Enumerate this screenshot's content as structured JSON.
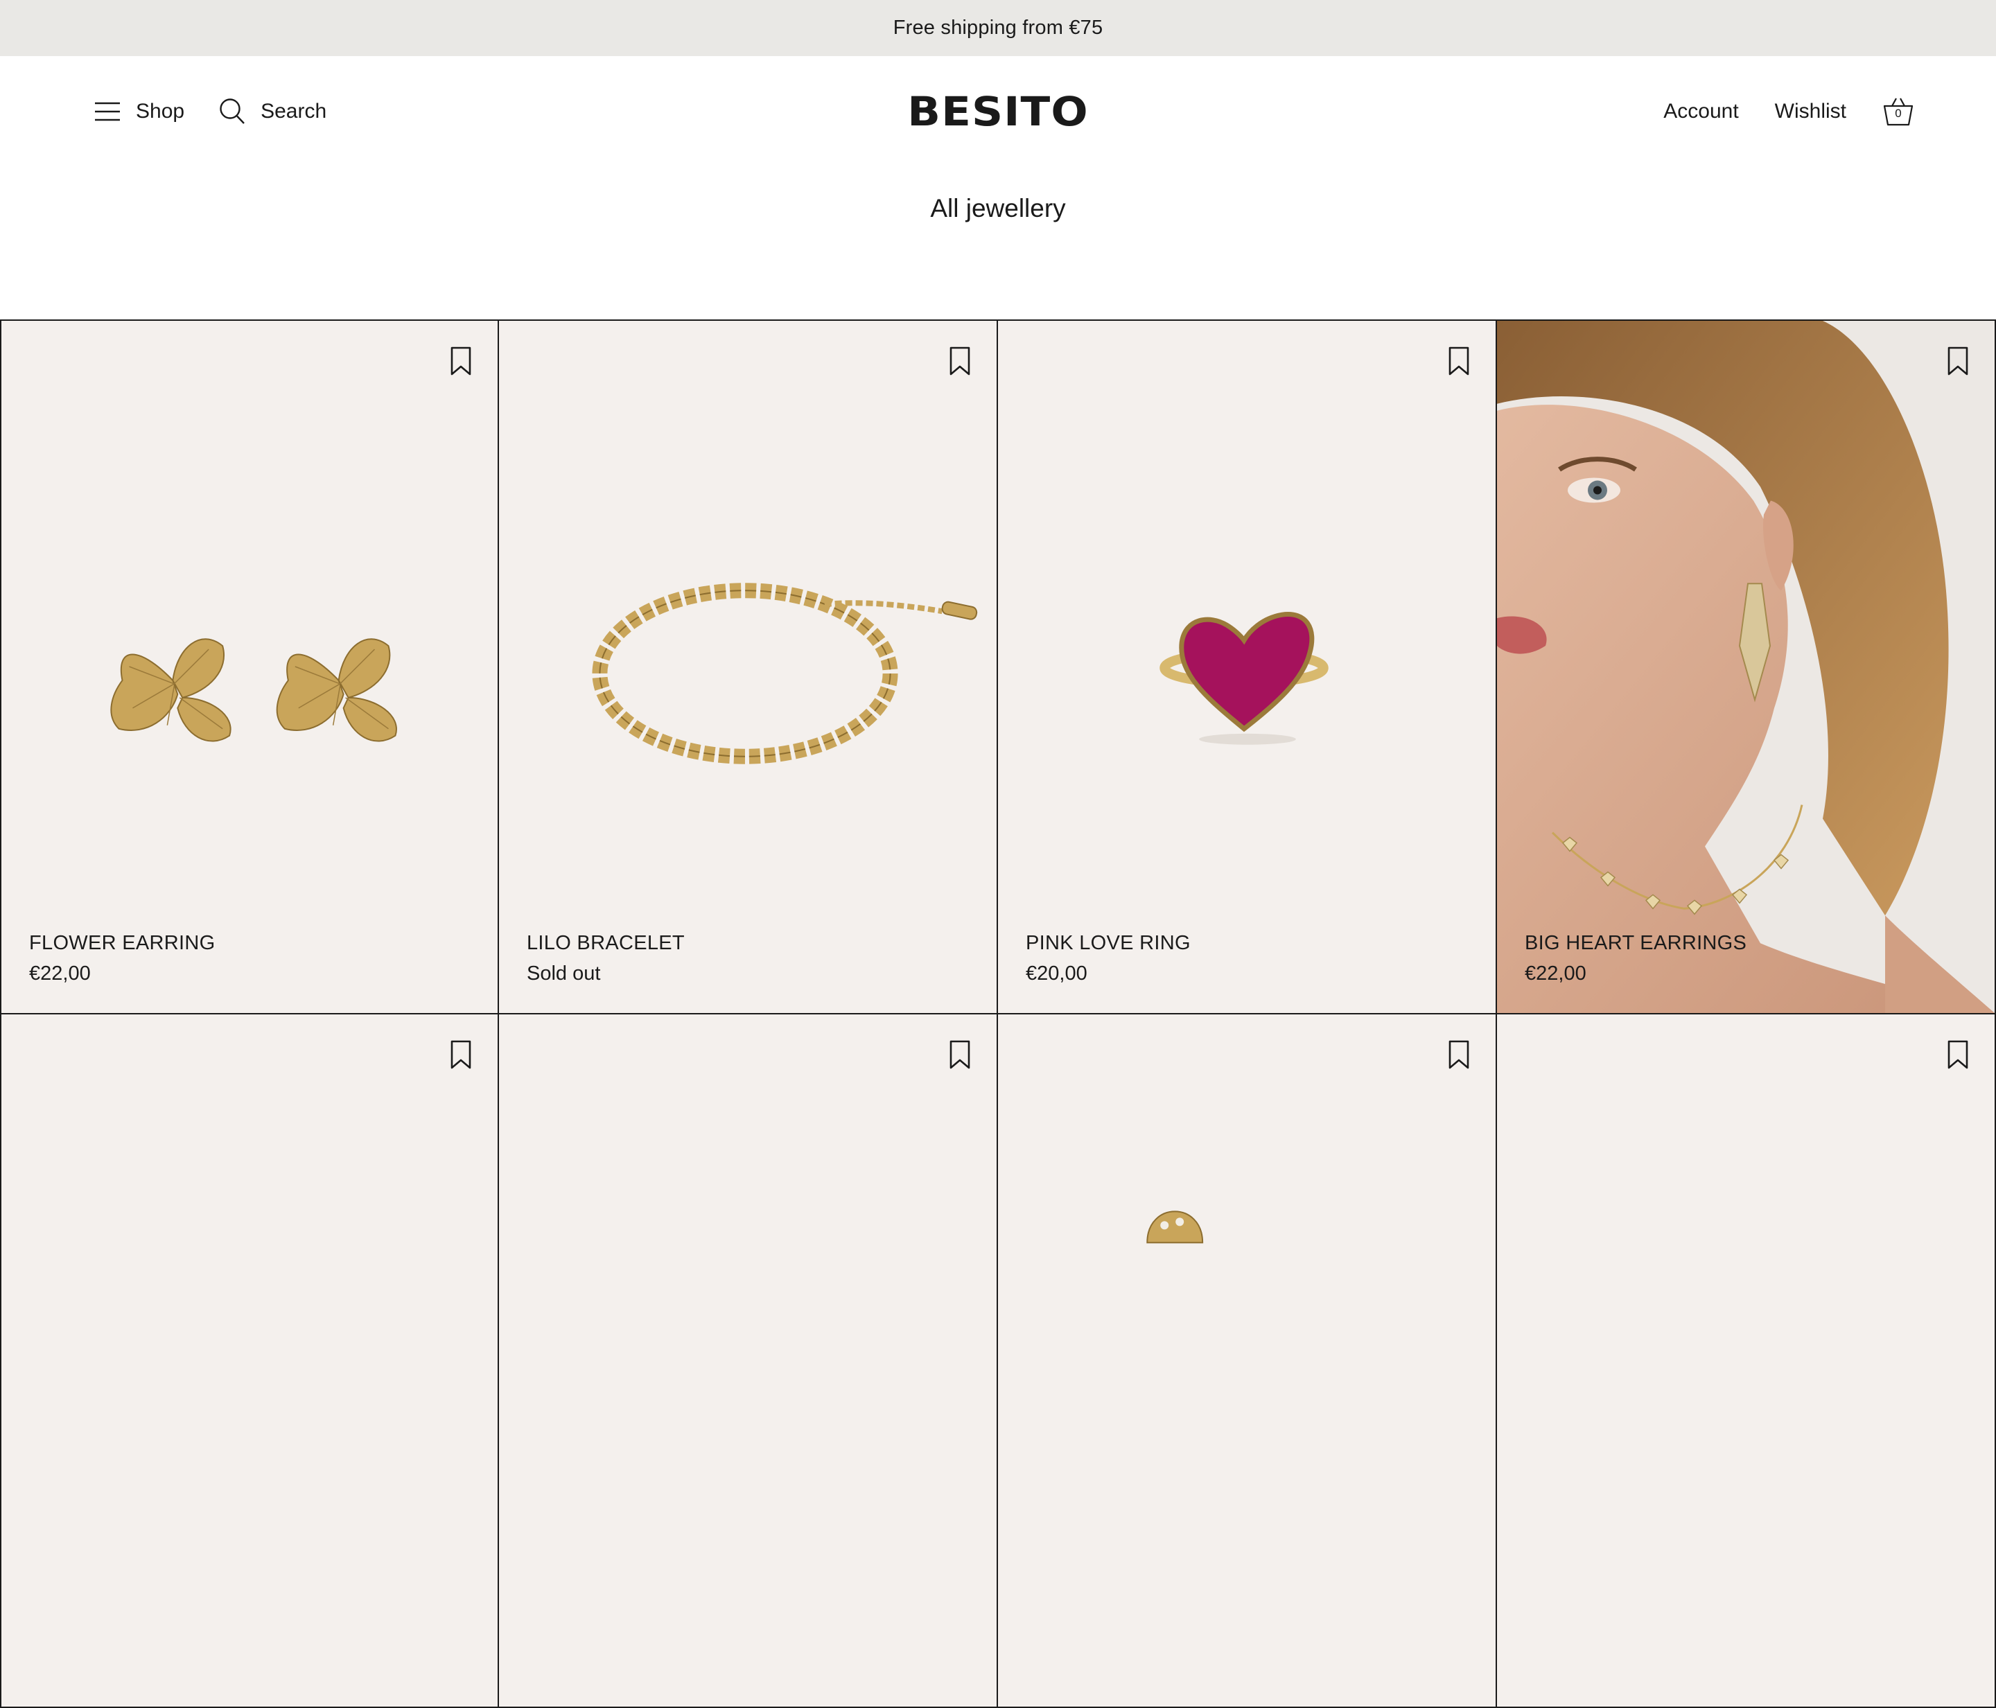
{
  "announcement": "Free shipping from €75",
  "header": {
    "shop_label": "Shop",
    "search_label": "Search",
    "logo": "BESITO",
    "account_label": "Account",
    "wishlist_label": "Wishlist",
    "cart_count": "0"
  },
  "page_title": "All jewellery",
  "products": [
    {
      "name": "FLOWER EARRING",
      "price": "€22,00"
    },
    {
      "name": "LILO BRACELET",
      "price": "Sold out"
    },
    {
      "name": "PINK LOVE RING",
      "price": "€20,00"
    },
    {
      "name": "BIG HEART EARRINGS",
      "price": "€22,00"
    },
    {
      "name": "",
      "price": ""
    },
    {
      "name": "",
      "price": ""
    },
    {
      "name": "",
      "price": ""
    },
    {
      "name": "",
      "price": ""
    }
  ],
  "colors": {
    "announcement_bg": "#e9e8e5",
    "card_bg": "#f4f0ed",
    "gold": "#c9a55a",
    "heart_pink": "#a5125c",
    "text": "#1a1a1a"
  },
  "icons": [
    "menu-icon",
    "search-icon",
    "basket-icon",
    "bookmark-icon"
  ]
}
